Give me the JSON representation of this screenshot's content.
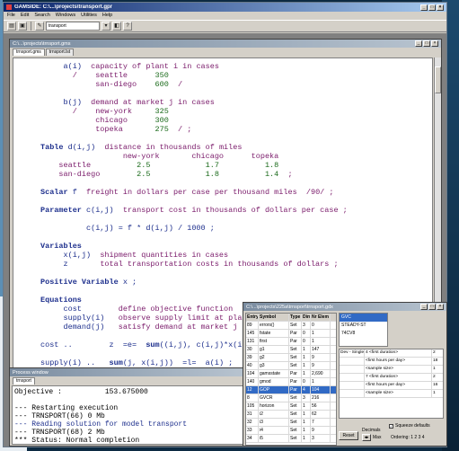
{
  "window": {
    "title": "GAMSIDE: C:\\...\\projects\\transport.gpr",
    "controls": [
      "_",
      "□",
      "×"
    ]
  },
  "menu": [
    "File",
    "Edit",
    "Search",
    "Windows",
    "Utilities",
    "Help"
  ],
  "toolbar": {
    "selector_value": "transport",
    "icons": [
      "open-icon",
      "save-icon",
      "run-icon",
      "model-library-icon",
      "gdx-icon",
      "help-icon"
    ]
  },
  "editor": {
    "title": "C:\\...\\projects\\trnsport.gms",
    "tabs": [
      "trnsport.gms",
      "trnsport.lst"
    ],
    "lines": [
      {
        "y": 0,
        "parts": [
          [
            "tx",
            "     "
          ],
          [
            "nm",
            "a(i)  "
          ],
          [
            "tx",
            "capacity of plant i in cases"
          ]
        ]
      },
      {
        "y": 1,
        "parts": [
          [
            "tx",
            "       /    seattle      "
          ],
          [
            "num",
            "350"
          ]
        ]
      },
      {
        "y": 2,
        "parts": [
          [
            "tx",
            "            san-diego    "
          ],
          [
            "num",
            "600"
          ],
          [
            "tx",
            "  /"
          ]
        ]
      },
      {
        "y": 4,
        "parts": [
          [
            "tx",
            "     "
          ],
          [
            "nm",
            "b(j)  "
          ],
          [
            "tx",
            "demand at market j in cases"
          ]
        ]
      },
      {
        "y": 5,
        "parts": [
          [
            "tx",
            "       /    new-york     "
          ],
          [
            "num",
            "325"
          ]
        ]
      },
      {
        "y": 6,
        "parts": [
          [
            "tx",
            "            chicago      "
          ],
          [
            "num",
            "300"
          ]
        ]
      },
      {
        "y": 7,
        "parts": [
          [
            "tx",
            "            topeka       "
          ],
          [
            "num",
            "275"
          ],
          [
            "tx",
            "  / ;"
          ]
        ]
      },
      {
        "y": 9,
        "parts": [
          [
            "kw",
            "Table "
          ],
          [
            "nm",
            "d(i,j)  "
          ],
          [
            "tx",
            "distance in thousands of miles"
          ]
        ]
      },
      {
        "y": 10,
        "parts": [
          [
            "tx",
            "                  new-york       chicago      topeka"
          ]
        ]
      },
      {
        "y": 11,
        "parts": [
          [
            "tx",
            "    seattle          "
          ],
          [
            "num",
            "2.5            1.7          1.8"
          ]
        ]
      },
      {
        "y": 12,
        "parts": [
          [
            "tx",
            "    san-diego        "
          ],
          [
            "num",
            "2.5            1.8          1.4"
          ],
          [
            "tx",
            "  ;"
          ]
        ]
      },
      {
        "y": 14,
        "parts": [
          [
            "kw",
            "Scalar "
          ],
          [
            "nm",
            "f  "
          ],
          [
            "tx",
            "freight in dollars per case per thousand miles  /90/ ;"
          ]
        ]
      },
      {
        "y": 16,
        "parts": [
          [
            "kw",
            "Parameter "
          ],
          [
            "nm",
            "c(i,j)  "
          ],
          [
            "tx",
            "transport cost in thousands of dollars per case ;"
          ]
        ]
      },
      {
        "y": 18,
        "parts": [
          [
            "nm",
            "          c(i,j) = f * d(i,j) / 1000 ;"
          ]
        ]
      },
      {
        "y": 20,
        "parts": [
          [
            "kw",
            "Variables"
          ]
        ]
      },
      {
        "y": 21,
        "parts": [
          [
            "nm",
            "     x(i,j)  "
          ],
          [
            "tx",
            "shipment quantities in cases"
          ]
        ]
      },
      {
        "y": 22,
        "parts": [
          [
            "nm",
            "     z       "
          ],
          [
            "tx",
            "total transportation costs in thousands of dollars ;"
          ]
        ]
      },
      {
        "y": 24,
        "parts": [
          [
            "kw",
            "Positive Variable "
          ],
          [
            "nm",
            "x ;"
          ]
        ]
      },
      {
        "y": 26,
        "parts": [
          [
            "kw",
            "Equations"
          ]
        ]
      },
      {
        "y": 27,
        "parts": [
          [
            "nm",
            "     cost        "
          ],
          [
            "tx",
            "define objective function"
          ]
        ]
      },
      {
        "y": 28,
        "parts": [
          [
            "nm",
            "     supply(i)   "
          ],
          [
            "tx",
            "observe supply limit at plant i"
          ]
        ]
      },
      {
        "y": 29,
        "parts": [
          [
            "nm",
            "     demand(j)   "
          ],
          [
            "tx",
            "satisfy demand at market j ;"
          ]
        ]
      },
      {
        "y": 31,
        "parts": [
          [
            "nm",
            "cost ..        z  =e=  "
          ],
          [
            "kw",
            "sum"
          ],
          [
            "nm",
            "((i,j), c(i,j)*x(i,j)) ;"
          ]
        ]
      },
      {
        "y": 33,
        "parts": [
          [
            "nm",
            "supply(i) ..   "
          ],
          [
            "kw",
            "sum"
          ],
          [
            "nm",
            "(j, x(i,j))  =l=  a(i) ;"
          ]
        ]
      },
      {
        "y": 35,
        "parts": [
          [
            "nm",
            "demand(j) ..   "
          ],
          [
            "kw",
            "sum"
          ],
          [
            "nm",
            "(i, x(i,j))  =g=  b(j) ;"
          ]
        ]
      },
      {
        "y": 37,
        "parts": [
          [
            "kw",
            "Model "
          ],
          [
            "nm",
            "transport /all/ ;"
          ]
        ]
      },
      {
        "y": 39,
        "parts": [
          [
            "kw",
            "Solve "
          ],
          [
            "nm",
            "transport using lp minimizing z ;"
          ]
        ]
      }
    ]
  },
  "log": {
    "title": "Process window",
    "tab": "trnsport",
    "lines": [
      {
        "text": "Objective :          153.675000",
        "cls": ""
      },
      {
        "text": "",
        "cls": ""
      },
      {
        "text": "--- Restarting execution",
        "cls": ""
      },
      {
        "text": "--- TRNSPORT(66) 0 Mb",
        "cls": ""
      },
      {
        "text": "--- Reading solution for model transport",
        "cls": "blue"
      },
      {
        "text": "--- TRNSPORT(68) 2 Mb",
        "cls": ""
      },
      {
        "text": "*** Status: Normal completion",
        "cls": ""
      }
    ]
  },
  "gdx": {
    "title": "C:\\...\\projects\\225a\\trnsport\\trnsport.gdx",
    "headers": [
      "Entry",
      "Symbol",
      "Type",
      "Dim",
      "Nr Elem"
    ],
    "rows": [
      [
        "89",
        "errors()",
        "Set",
        "3",
        "0"
      ],
      [
        "145",
        "fstate",
        "Par",
        "0",
        "1"
      ],
      [
        "131",
        "first",
        "Par",
        "0",
        "1"
      ],
      [
        "30",
        "g1",
        "Set",
        "1",
        "147"
      ],
      [
        "39",
        "g2",
        "Set",
        "1",
        "9"
      ],
      [
        "40",
        "g3",
        "Set",
        "1",
        "9"
      ],
      [
        "104",
        "gamsstate",
        "Par",
        "1",
        "2,690"
      ],
      [
        "140",
        "gmod",
        "Par",
        "0",
        "1"
      ],
      [
        "12",
        "GOP",
        "Par",
        "4",
        "104"
      ],
      [
        "8",
        "GVCR",
        "Set",
        "3",
        "216"
      ],
      [
        "105",
        "horizon",
        "Set",
        "1",
        "56"
      ],
      [
        "31",
        "i2",
        "Set",
        "1",
        "62"
      ],
      [
        "32",
        "i3",
        "Set",
        "1",
        "7"
      ],
      [
        "33",
        "i4",
        "Set",
        "1",
        "9"
      ],
      [
        "34",
        "i5",
        "Set",
        "1",
        "3"
      ]
    ],
    "selected_row": 8,
    "symbols": [
      "GVC",
      "STEADY-ST",
      "74CV8"
    ],
    "selected_symbol": 0,
    "options": [
      [
        "Dev - Single",
        "4 <first duration>",
        "2"
      ],
      [
        "",
        "<first hours per day>",
        "18"
      ],
      [
        "",
        "<sample size>",
        "1"
      ],
      [
        "",
        "7 <first duration>",
        "2"
      ],
      [
        "",
        "<first hours per day>",
        "16"
      ],
      [
        "",
        "<sample size>",
        "1"
      ]
    ],
    "reset_label": "Reset",
    "decimals_label": "Decimals",
    "max_label": "Max",
    "squeeze_label": "Squeeze defaults",
    "ordering_label": "Ordering: 1 2 3 4"
  }
}
